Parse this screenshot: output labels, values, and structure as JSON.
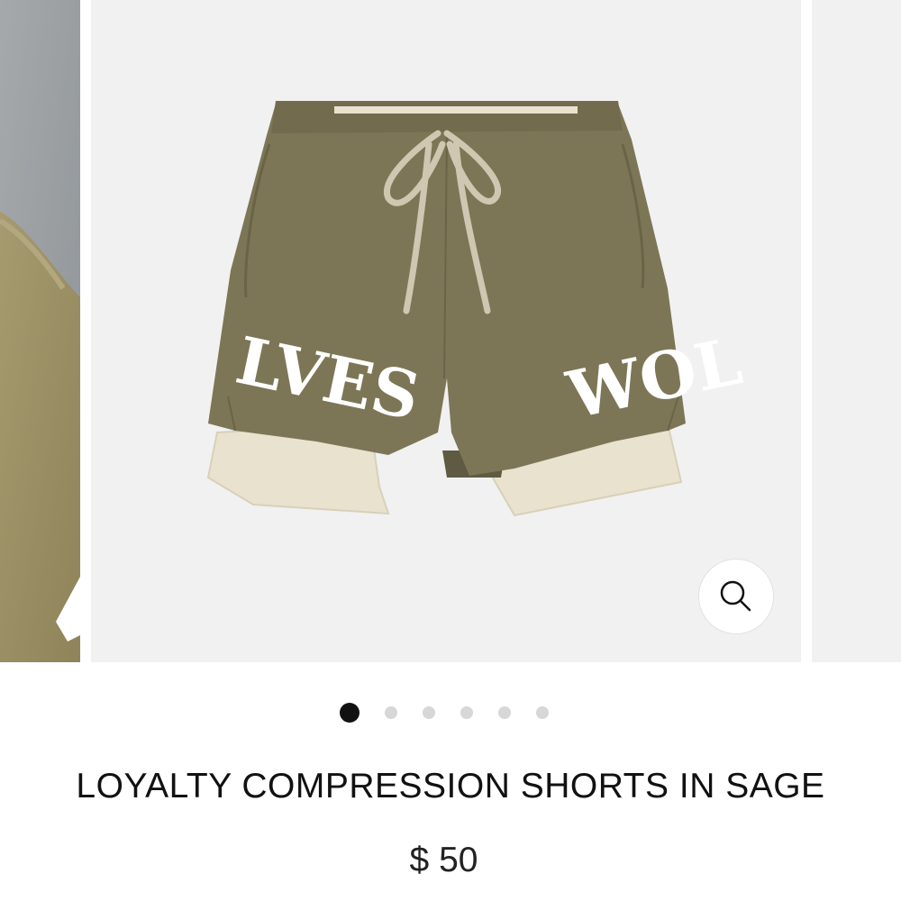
{
  "product": {
    "title": "LOYALTY COMPRESSION SHORTS IN SAGE",
    "price": "$ 50",
    "image_text_left": "LVES",
    "image_text_right": "WOL"
  },
  "gallery": {
    "active_index": 0,
    "total_images": 6,
    "zoom_icon": "magnifier-icon"
  },
  "colors": {
    "shorts": "#7d7656",
    "liner": "#e8e2cf",
    "drawstring": "#cfc7b1",
    "dot_active": "#111111",
    "dot_inactive": "#d7d7d7"
  }
}
